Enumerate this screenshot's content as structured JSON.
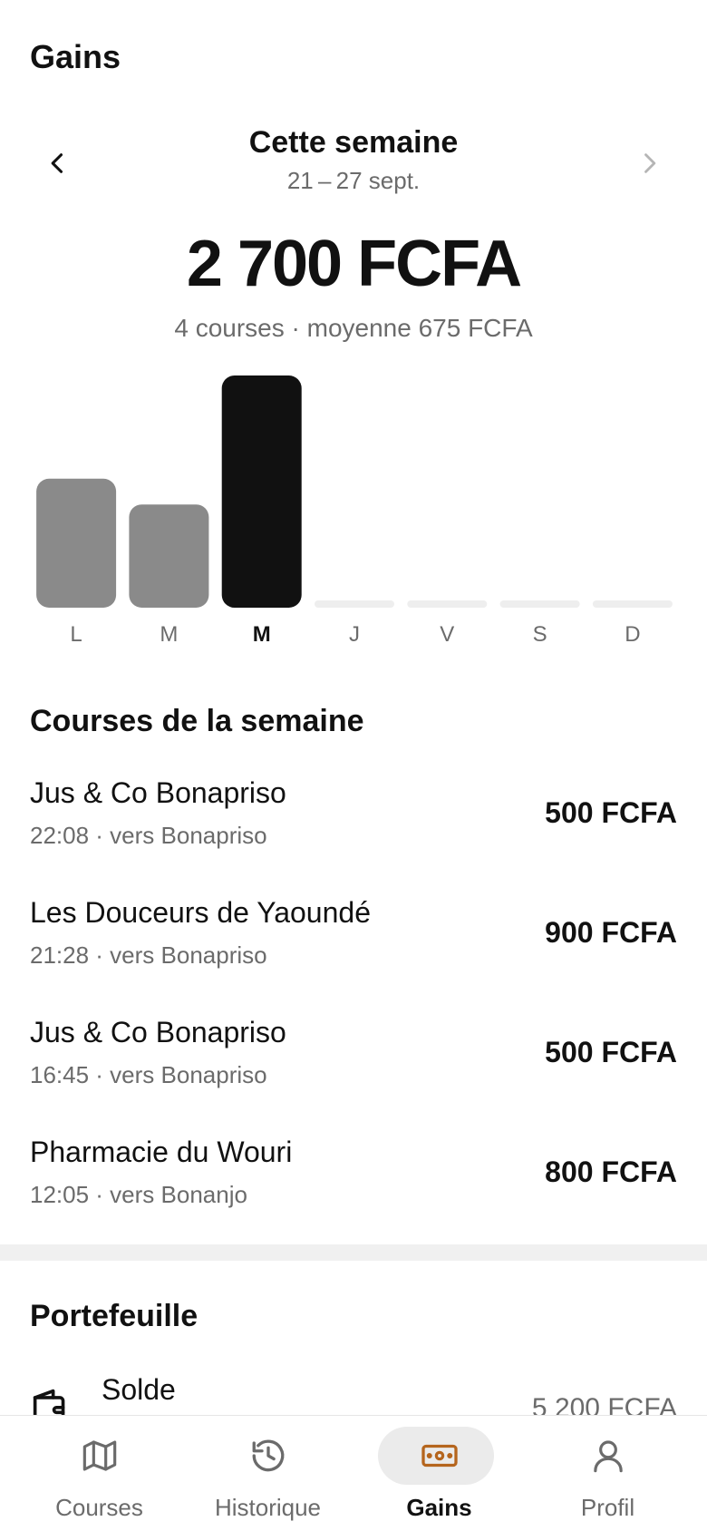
{
  "header": {
    "title": "Gains"
  },
  "week": {
    "title": "Cette semaine",
    "range": "21 – 27 sept."
  },
  "summary": {
    "total": "2 700 FCFA",
    "details": "4 courses · moyenne 675 FCFA"
  },
  "chart_data": {
    "type": "bar",
    "categories": [
      "L",
      "M",
      "M",
      "J",
      "V",
      "S",
      "D"
    ],
    "values": [
      500,
      400,
      900,
      0,
      0,
      0,
      0
    ],
    "highlight_index": 2,
    "colors": {
      "default": "#8a8a8a",
      "highlight": "#111111",
      "empty": "#eeeeee"
    }
  },
  "rides": {
    "title": "Courses de la semaine",
    "items": [
      {
        "name": "Jus & Co Bonapriso",
        "meta": "22:08 · vers Bonapriso",
        "amount": "500 FCFA"
      },
      {
        "name": "Les Douceurs de Yaoundé",
        "meta": "21:28 · vers Bonapriso",
        "amount": "900 FCFA"
      },
      {
        "name": "Jus & Co Bonapriso",
        "meta": "16:45 · vers Bonapriso",
        "amount": "500 FCFA"
      },
      {
        "name": "Pharmacie du Wouri",
        "meta": "12:05 · vers Bonanjo",
        "amount": "800 FCFA"
      }
    ]
  },
  "wallet": {
    "title": "Portefeuille",
    "balance_label": "Solde",
    "balance_amount": "5 200 FCFA"
  },
  "tabs": [
    {
      "label": "Courses",
      "icon": "map-icon"
    },
    {
      "label": "Historique",
      "icon": "history-icon"
    },
    {
      "label": "Gains",
      "icon": "banknote-icon"
    },
    {
      "label": "Profil",
      "icon": "user-icon"
    }
  ],
  "active_tab": "Gains",
  "colors": {
    "accent": "#b5651d",
    "text": "#111111",
    "muted": "#6b6b6b"
  }
}
